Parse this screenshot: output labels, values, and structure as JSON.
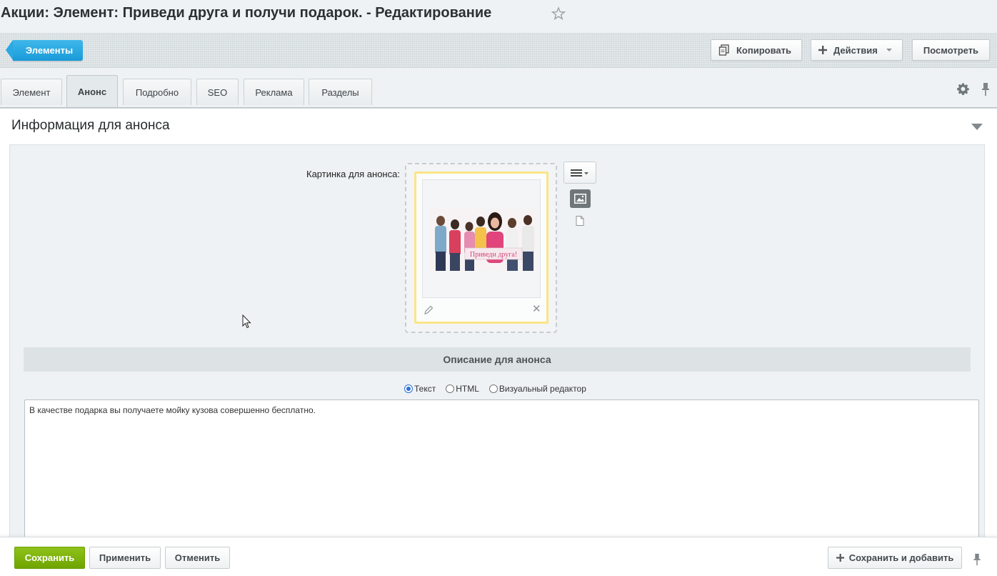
{
  "page": {
    "title": "Акции: Элемент: Приведи друга и получи подарок. - Редактирование"
  },
  "toolbar": {
    "back_label": "Элементы",
    "copy_label": "Копировать",
    "actions_label": "Действия",
    "view_label": "Посмотреть"
  },
  "tabs": [
    {
      "label": "Элемент",
      "active": false
    },
    {
      "label": "Анонс",
      "active": true
    },
    {
      "label": "Подробно",
      "active": false
    },
    {
      "label": "SEO",
      "active": false
    },
    {
      "label": "Реклама",
      "active": false
    },
    {
      "label": "Разделы",
      "active": false
    }
  ],
  "section": {
    "title": "Информация для анонса",
    "picture_label": "Картинка для анонса:",
    "picture_caption": "Приведи друга!",
    "description_header": "Описание для анонса",
    "format_options": [
      {
        "label": "Текст",
        "selected": true
      },
      {
        "label": "HTML",
        "selected": false
      },
      {
        "label": "Визуальный редактор",
        "selected": false
      }
    ],
    "description_text": "В качестве подарка вы получаете мойку кузова совершенно бесплатно."
  },
  "footer": {
    "save_label": "Сохранить",
    "apply_label": "Применить",
    "cancel_label": "Отменить",
    "save_add_label": "Сохранить и добавить"
  },
  "colors": {
    "accent_blue": "#1a9ad9",
    "save_green": "#6fa500",
    "picture_border": "#fbe586"
  }
}
